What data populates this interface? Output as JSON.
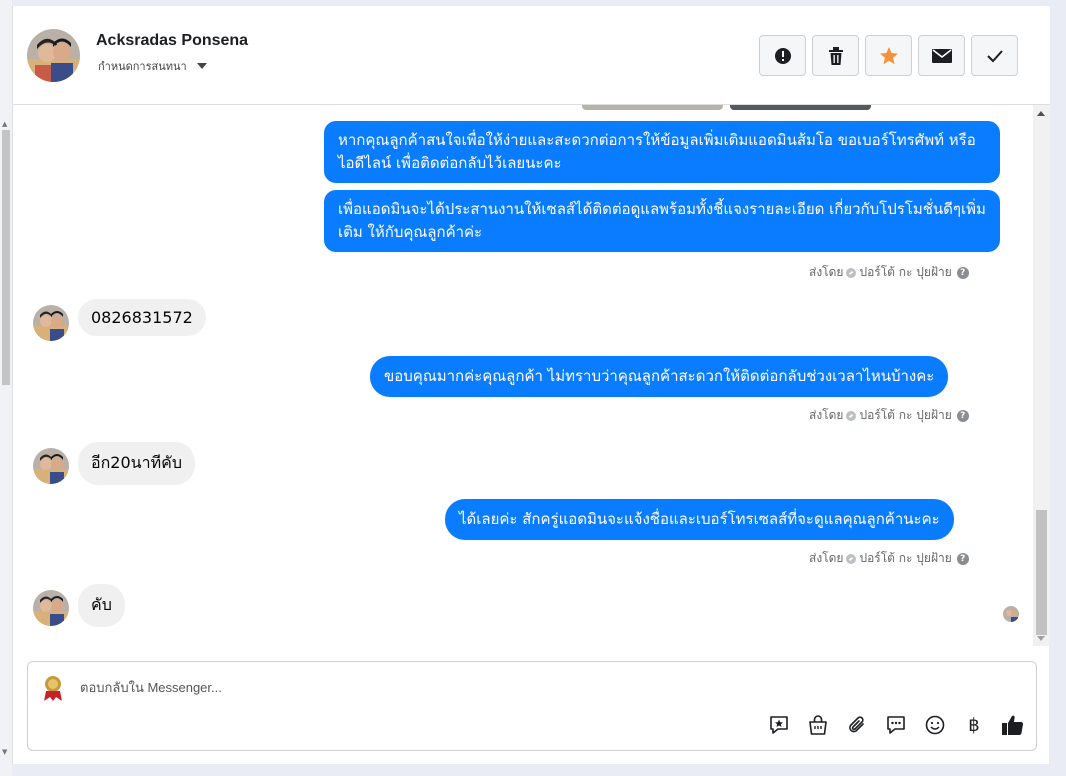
{
  "header": {
    "name": "Acksradas Ponsena",
    "subtitle": "กำหนดการสนทนา"
  },
  "actions": [
    {
      "icon": "alert-icon",
      "name": "report-button"
    },
    {
      "icon": "trash-icon",
      "name": "delete-button"
    },
    {
      "icon": "star-icon",
      "name": "star-button",
      "color": "#f7923b"
    },
    {
      "icon": "envelope-icon",
      "name": "mark-unread-button"
    },
    {
      "icon": "check-icon",
      "name": "mark-done-button"
    }
  ],
  "messages": [
    {
      "from": "page",
      "text": "หากคุณลูกค้าสนใจเพื่อให้ง่ายและสะดวกต่อการให้ข้อมูลเพิ่มเติมแอดมินส้มโอ ขอเบอร์โทรศัพท์ หรือ ไอดีไลน์ เพื่อติดต่อกลับไว้เลยนะคะ"
    },
    {
      "from": "page",
      "text": "เพื่อแอดมินจะได้ประสานงานให้เซลส์ได้ติดต่อดูแลพร้อมทั้งชี้แจงรายละเอียด เกี่ยวกับโปรโมชั่นดีๆเพิ่มเติม ให้กับคุณลูกค้าค่ะ"
    },
    {
      "from": "customer",
      "text": "0826831572"
    },
    {
      "from": "page",
      "text": "ขอบคุณมากค่ะคุณลูกค้า ไม่ทราบว่าคุณลูกค้าสะดวกให้ติดต่อกลับช่วงเวลาไหนบ้างคะ"
    },
    {
      "from": "customer",
      "text": "อีก20นาทีคับ"
    },
    {
      "from": "page",
      "text": "ได้เลยค่ะ สักครู่แอดมินจะแจ้งชื่อและเบอร์โทรเซลส์ที่จะดูแลคุณลูกค้านะคะ"
    },
    {
      "from": "customer",
      "text": "คับ"
    }
  ],
  "sent_by": {
    "label": "ส่งโดย",
    "sender": "ปอร์โต้ กะ ปุยฝ้าย",
    "help": "?"
  },
  "composer": {
    "placeholder": "ตอบกลับใน Messenger...",
    "baht_symbol": "฿"
  },
  "colors": {
    "outgoing_bubble": "#0a7cff",
    "incoming_bubble": "#f0f0f0",
    "star": "#f7923b"
  }
}
